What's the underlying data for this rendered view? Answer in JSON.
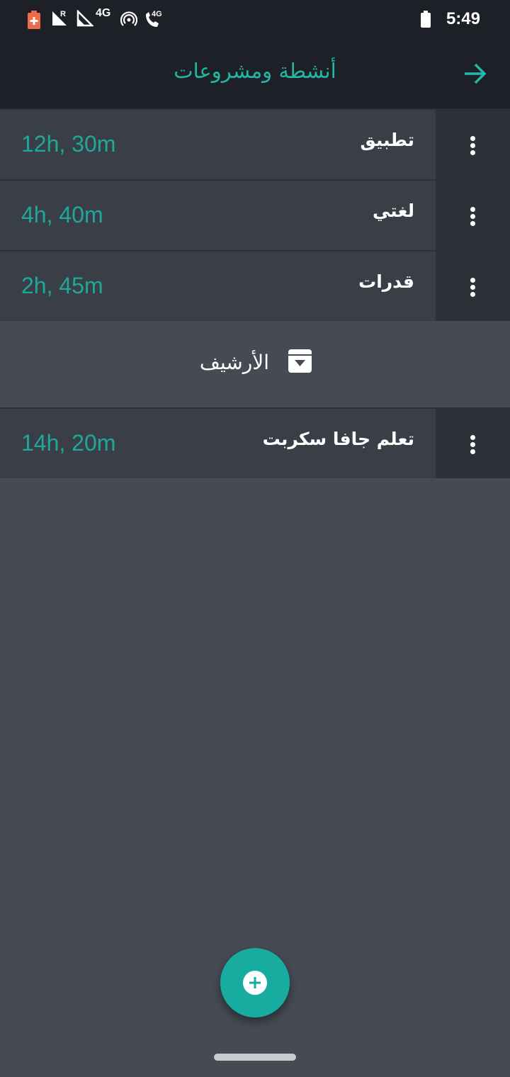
{
  "status_bar": {
    "time": "5:49",
    "icons": [
      "battery-saver-icon",
      "signal-roaming-icon",
      "signal-icon",
      "network-4g-icon",
      "hotspot-icon",
      "volte-call-icon",
      "battery-icon"
    ],
    "network_label": "4G",
    "roaming_label": "R",
    "call_label": "4G"
  },
  "header": {
    "title": "أنشطة ومشروعات",
    "back_icon": "arrow-right-icon"
  },
  "projects": [
    {
      "name": "تطبيق",
      "duration": "12h, 30m"
    },
    {
      "name": "لغتي",
      "duration": "4h, 40m"
    },
    {
      "name": "قدرات",
      "duration": "2h, 45m"
    }
  ],
  "archive": {
    "label": "الأرشيف",
    "icon": "archive-icon",
    "items": [
      {
        "name": "تعلم جافا سكربت",
        "duration": "14h, 20m"
      }
    ]
  },
  "fab": {
    "icon": "add-icon"
  },
  "colors": {
    "accent": "#22b7a6",
    "duration_text": "#1fa89a",
    "background": "#454a53",
    "row_background": "#3a3e46",
    "bar_background": "#1d2027"
  }
}
